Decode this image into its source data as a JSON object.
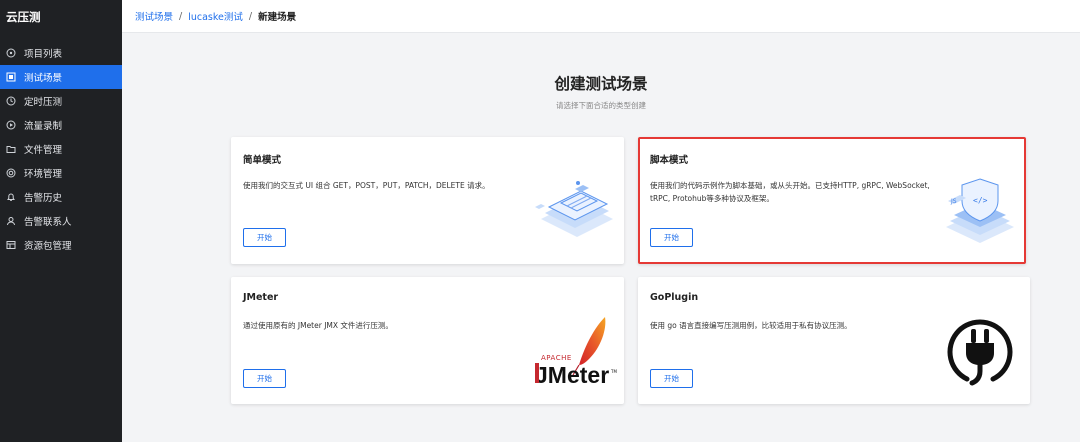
{
  "app": {
    "brand": "云压测"
  },
  "sidebar": {
    "items": [
      {
        "label": "项目列表",
        "icon": "project-list-icon",
        "active": false
      },
      {
        "label": "测试场景",
        "icon": "test-scene-icon",
        "active": true
      },
      {
        "label": "定时压测",
        "icon": "clock-icon",
        "active": false
      },
      {
        "label": "流量录制",
        "icon": "record-icon",
        "active": false
      },
      {
        "label": "文件管理",
        "icon": "folder-icon",
        "active": false
      },
      {
        "label": "环境管理",
        "icon": "environment-icon",
        "active": false
      },
      {
        "label": "告警历史",
        "icon": "bell-icon",
        "active": false
      },
      {
        "label": "告警联系人",
        "icon": "contact-icon",
        "active": false
      },
      {
        "label": "资源包管理",
        "icon": "package-icon",
        "active": false
      }
    ]
  },
  "breadcrumb": {
    "items": [
      "测试场景",
      "lucaske测试"
    ],
    "separator": "/",
    "current": "新建场景"
  },
  "header": {
    "title": "创建测试场景",
    "subtitle": "请选择下面合适的类型创建"
  },
  "cards": [
    {
      "title": "简单模式",
      "desc_lines": [
        "使用我们的交互式 UI 组合 GET，POST，PUT，PATCH，DELETE 请求。"
      ],
      "button": "开始",
      "illustration": "browser-stack-illustration",
      "highlighted": false
    },
    {
      "title": "脚本模式",
      "desc_lines": [
        "使用我们的代码示例作为脚本基础，或从头开始。已支持HTTP, gRPC, WebSocket,",
        "tRPC, Protohub等多种协议及框架。"
      ],
      "button": "开始",
      "illustration": "code-stack-illustration",
      "highlighted": true
    },
    {
      "title": "JMeter",
      "desc_lines": [
        "通过使用原有的 JMeter JMX 文件进行压测。"
      ],
      "button": "开始",
      "illustration": "jmeter-logo",
      "logo_text": {
        "apache": "APACHE",
        "name": "JMeter",
        "tm": "TM"
      },
      "highlighted": false
    },
    {
      "title": "GoPlugin",
      "desc_lines": [
        "使用 go 语言直接编写压测用例，比较适用于私有协议压测。"
      ],
      "button": "开始",
      "illustration": "plug-icon",
      "highlighted": false
    }
  ],
  "colors": {
    "sidebar_bg": "#1f2124",
    "accent": "#1f6feb",
    "highlight_border": "#e53935",
    "page_bg": "#f3f4f6"
  }
}
